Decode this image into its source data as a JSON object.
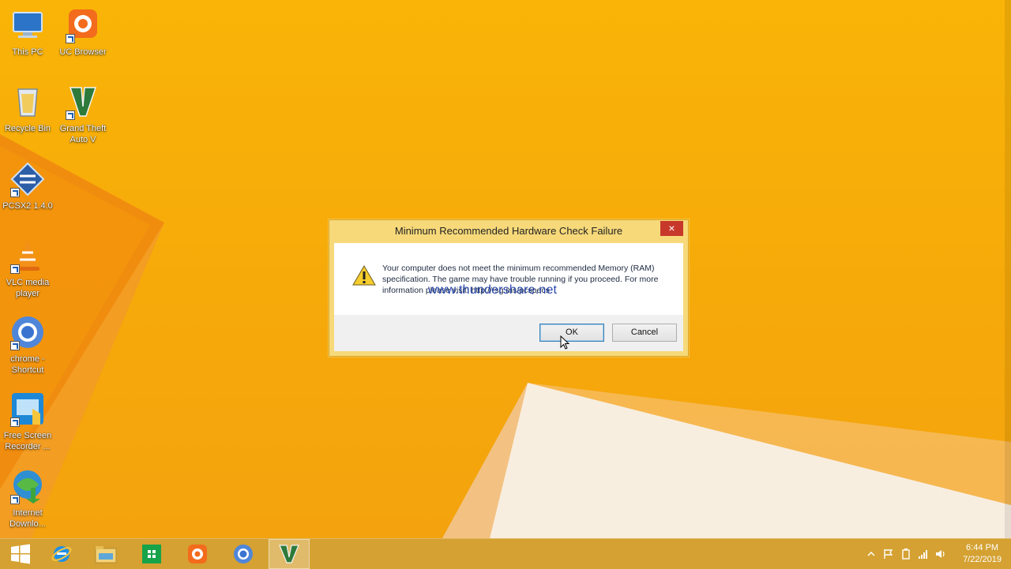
{
  "desktop": {
    "icons": [
      {
        "label": "This PC"
      },
      {
        "label": "UC Browser"
      },
      {
        "label": "Recycle Bin"
      },
      {
        "label": "Grand Theft Auto V"
      },
      {
        "label": "PCSX2 1.4.0"
      },
      {
        "label": "VLC media player"
      },
      {
        "label": "chrome - Shortcut"
      },
      {
        "label": "Free Screen Recorder ..."
      },
      {
        "label": "Internet Downlo..."
      }
    ]
  },
  "dialog": {
    "title": "Minimum Recommended Hardware Check Failure",
    "close_label": "×",
    "message": "Your computer does not meet the minimum recommended Memory (RAM) specification. The game may have trouble running if you proceed. For more information please visit: http://rsg.ms/pcspecs",
    "watermark": "www.thundershare.net",
    "ok_label": "OK",
    "cancel_label": "Cancel",
    "icon": "warning-icon"
  },
  "taskbar": {
    "items": [
      "start-icon",
      "internet-explorer-icon",
      "file-explorer-icon",
      "store-icon",
      "uc-browser-icon",
      "chrome-icon",
      "gta-v-icon"
    ],
    "active_item": "gta-v-icon",
    "clock_time": "6:44 PM",
    "clock_date": "7/22/2019"
  },
  "colors": {
    "wallpaper": "#f9b407",
    "dialog_frame": "#f7d97a",
    "close_red": "#c7382b",
    "watermark": "#1f3fa8"
  }
}
